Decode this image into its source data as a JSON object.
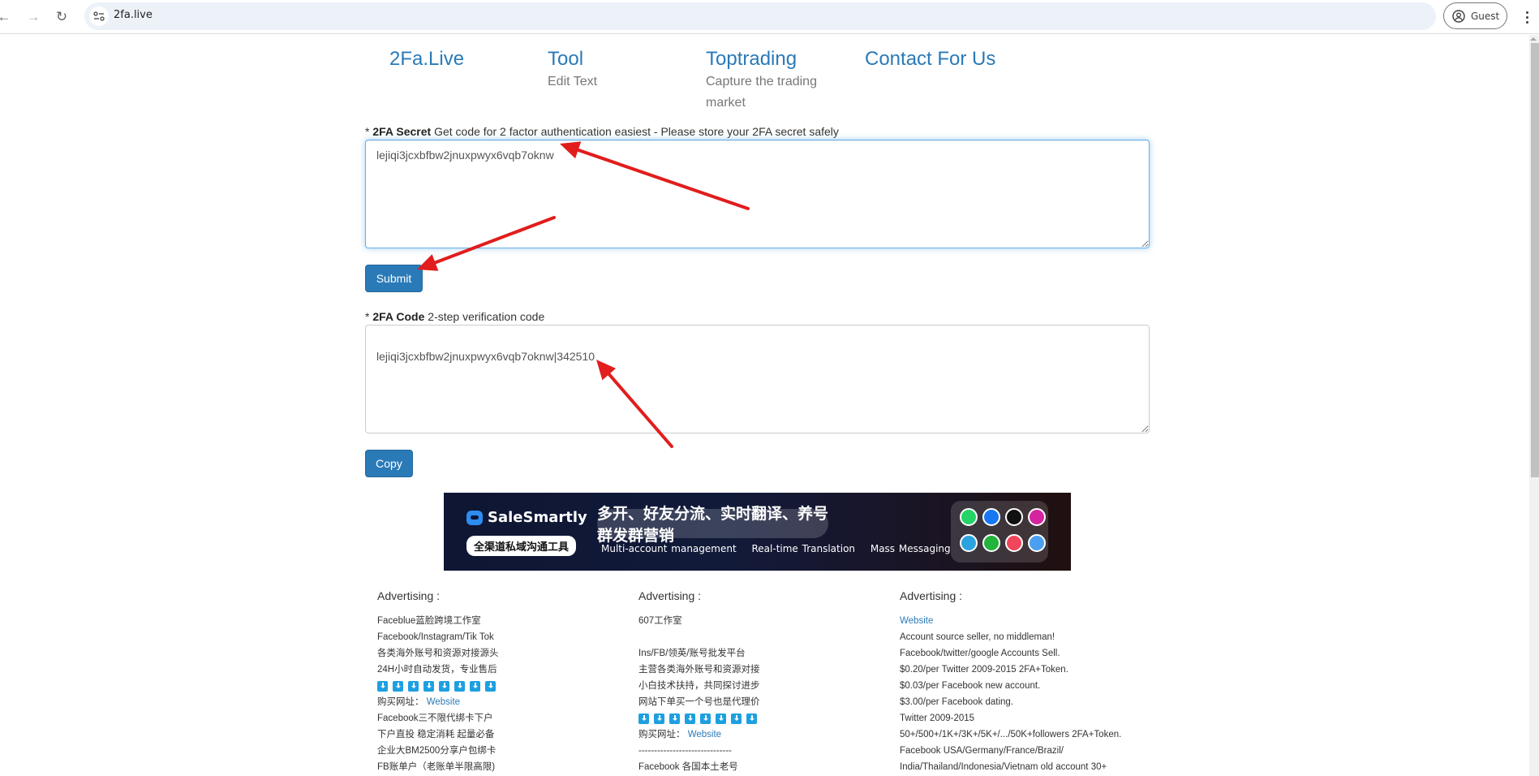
{
  "browser": {
    "url": "2fa.live",
    "profile_label": "Guest",
    "icons": [
      "back-icon",
      "forward-icon",
      "reload-icon",
      "site-info-icon",
      "profile-icon",
      "menu-icon"
    ]
  },
  "nav": [
    {
      "title": "2Fa.Live",
      "subtitle": ""
    },
    {
      "title": "Tool",
      "subtitle": "Edit Text"
    },
    {
      "title": "Toptrading",
      "subtitle": "Capture the trading market"
    },
    {
      "title": "Contact For Us",
      "subtitle": ""
    }
  ],
  "secret": {
    "required_mark": "*",
    "label_bold": "2FA Secret",
    "label_rest": " Get code for 2 factor authentication easiest - Please store your 2FA secret safely",
    "value": "lejiqi3jcxbfbw2jnuxpwyx6vqb7oknw",
    "submit_label": "Submit"
  },
  "code": {
    "required_mark": "*",
    "label_bold": "2FA Code",
    "label_rest": " 2-step verification code",
    "value": "\nlejiqi3jcxbfbw2jnuxpwyx6vqb7oknw|342510",
    "copy_label": "Copy"
  },
  "banner": {
    "brand": "SaleSmartly",
    "tagline": "全渠道私域沟通工具",
    "headline": "多开、好友分流、实时翻译、养号群发群营销",
    "features": [
      "Multi-account management",
      "Real-time Translation",
      "Mass Messaging"
    ],
    "app_icons": [
      {
        "name": "whatsapp-icon",
        "color": "#25d366"
      },
      {
        "name": "messenger-icon",
        "color": "#1877f2"
      },
      {
        "name": "tiktok-icon",
        "color": "#111111"
      },
      {
        "name": "instagram-icon",
        "color": "#d6249f"
      },
      {
        "name": "telegram-icon",
        "color": "#2aa3df"
      },
      {
        "name": "line-icon",
        "color": "#22b43c"
      },
      {
        "name": "email-icon",
        "color": "#f0455a"
      },
      {
        "name": "chat-icon",
        "color": "#4a9ff0"
      }
    ]
  },
  "ads": [
    {
      "heading": "Advertising :",
      "lines": [
        {
          "text": "Faceblue蓝脸跨境工作室"
        },
        {
          "text": "Facebook/Instagram/Tik Tok"
        },
        {
          "text": "各类海外账号和资源对接源头"
        },
        {
          "text": "24H小时自动发货，专业售后"
        },
        {
          "type": "download-icons",
          "count": 8
        },
        {
          "text": "购买网址： ",
          "link": "Website"
        },
        {
          "text": "Facebook三不限代绑卡下户"
        },
        {
          "text": "下户直投 稳定消耗 起量必备"
        },
        {
          "text": "企业大BM2500分享户包绑卡"
        },
        {
          "text": "FB账单户（老账单半限高限)"
        }
      ]
    },
    {
      "heading": "Advertising :",
      "lines": [
        {
          "text": "607工作室"
        },
        {
          "text": ""
        },
        {
          "text": "Ins/FB/领英/账号批发平台"
        },
        {
          "text": "主营各类海外账号和资源对接"
        },
        {
          "text": "小白技术扶持，共同探讨进步"
        },
        {
          "text": "网站下单买一个号也是代理价"
        },
        {
          "type": "download-icons",
          "count": 8
        },
        {
          "text": "购买网址： ",
          "link": "Website"
        },
        {
          "text": "------------------------------"
        },
        {
          "text": "Facebook 各国本土老号"
        }
      ]
    },
    {
      "heading": "Advertising :",
      "lines": [
        {
          "text": "",
          "link": "Website"
        },
        {
          "text": "Account source seller, no middleman!"
        },
        {
          "text": "Facebook/twitter/google Accounts Sell."
        },
        {
          "text": "$0.20/per Twitter 2009-2015 2FA+Token."
        },
        {
          "text": "$0.03/per Facebook new account."
        },
        {
          "text": "$3.00/per Facebook dating."
        },
        {
          "text": "Twitter 2009-2015"
        },
        {
          "text": "50+/500+/1K+/3K+/5K+/.../50K+followers 2FA+Token."
        },
        {
          "text": "Facebook USA/Germany/France/Brazil/"
        },
        {
          "text": "India/Thailand/Indonesia/Vietnam old account 30+"
        }
      ]
    }
  ],
  "colors": {
    "link": "#2a7ab8",
    "button": "#2a7ab8",
    "annotation_arrow": "#e11d1d",
    "focus_border": "#66afe9"
  },
  "scroll": {
    "position_fraction": 0.0
  }
}
